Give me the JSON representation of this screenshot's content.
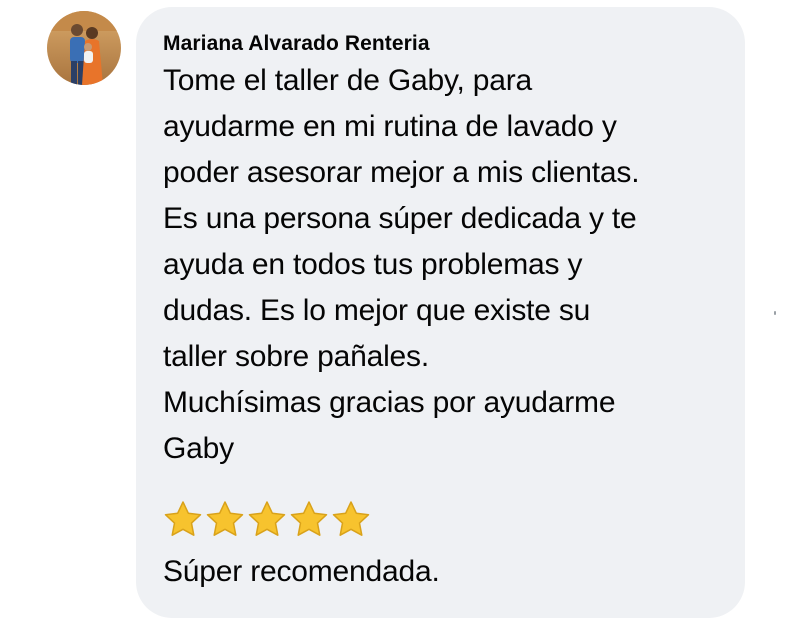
{
  "comment": {
    "author": "Mariana Alvarado Renteria",
    "avatar_icon": "profile-photo",
    "body_lines": [
      "Tome el taller de Gaby, para",
      "ayudarme en mi rutina de lavado y",
      "poder asesorar mejor a mis clientas.",
      "Es una persona súper dedicada y te",
      "ayuda en todos tus problemas y",
      "dudas. Es lo mejor que existe su",
      "taller sobre pañales.",
      "Muchísimas gracias por ayudarme",
      "Gaby"
    ],
    "stars": 5,
    "star_icon": "star-emoji-icon",
    "recommendation": "Súper recomendada.",
    "bubble_color": "#eff1f4",
    "star_color": "#f7c32e"
  }
}
